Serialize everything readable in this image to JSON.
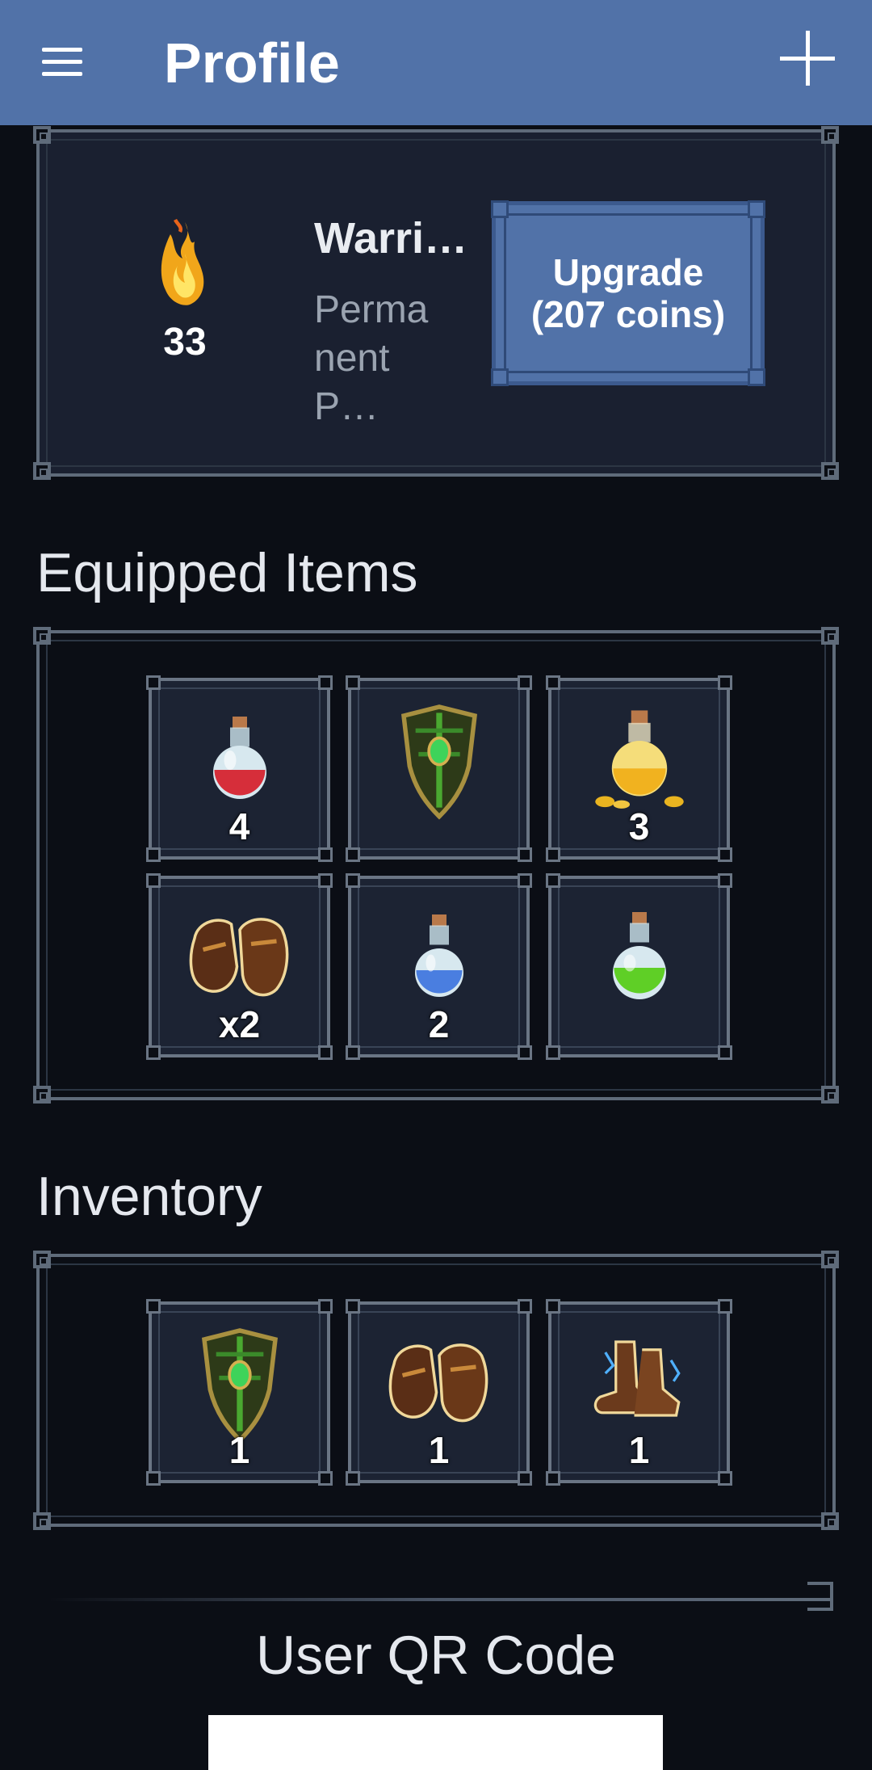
{
  "appbar": {
    "title": "Profile",
    "menu_icon": "hamburger-menu-icon",
    "add_icon": "plus-icon",
    "color": "#5172a8"
  },
  "skill_card": {
    "icon": "flame-icon",
    "count": "33",
    "name": "Warri…",
    "description": "Perma nent P…",
    "upgrade_label": "Upgrade (207 coins)"
  },
  "equipped": {
    "title": "Equipped Items",
    "items": [
      {
        "icon": "red-potion-icon",
        "qty": "4"
      },
      {
        "icon": "green-shield-icon",
        "qty": ""
      },
      {
        "icon": "gold-potion-icon",
        "qty": "3"
      },
      {
        "icon": "leather-gloves-icon",
        "qty": "x2"
      },
      {
        "icon": "blue-potion-icon",
        "qty": "2"
      },
      {
        "icon": "green-potion-icon",
        "qty": ""
      }
    ]
  },
  "inventory": {
    "title": "Inventory",
    "items": [
      {
        "icon": "green-shield-icon",
        "qty": "1"
      },
      {
        "icon": "leather-gloves-icon",
        "qty": "1"
      },
      {
        "icon": "lightning-boots-icon",
        "qty": "1"
      }
    ]
  },
  "qr": {
    "title": "User QR Code"
  }
}
